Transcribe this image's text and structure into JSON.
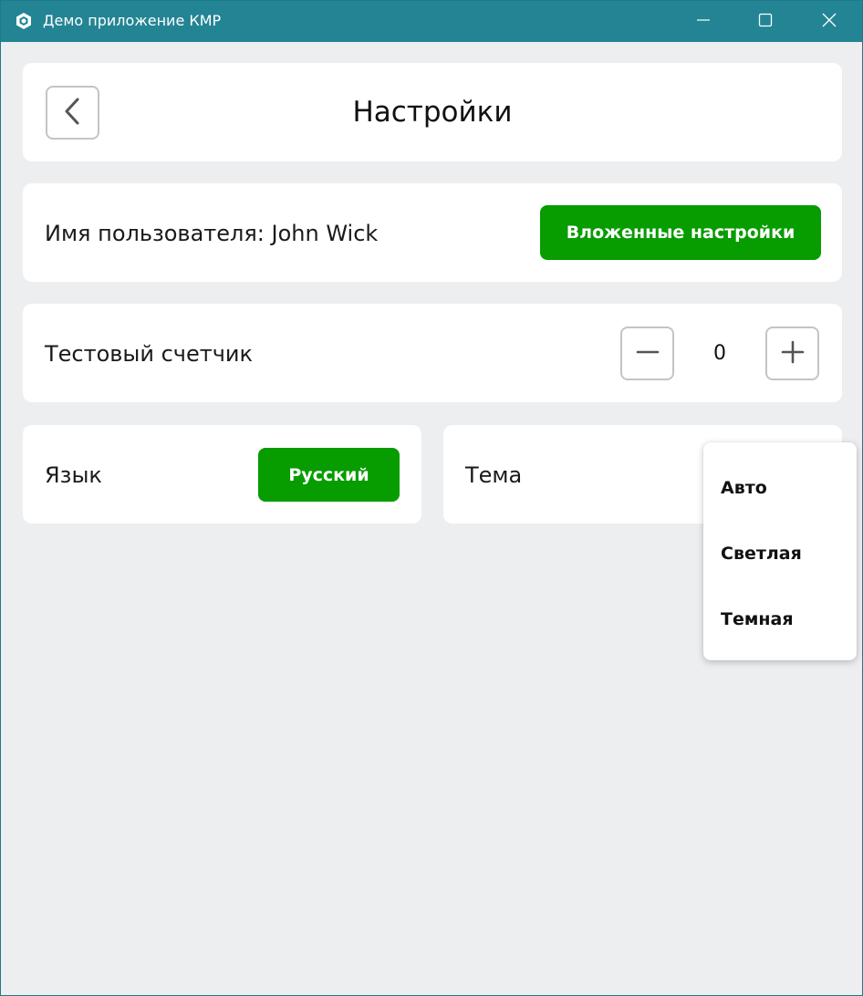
{
  "window": {
    "title": "Демо приложение КМР",
    "accent_color": "#238494",
    "icons": [
      "app-icon",
      "minimize-icon",
      "maximize-icon",
      "close-icon"
    ]
  },
  "header": {
    "title": "Настройки",
    "back_icon": "chevron-left-icon"
  },
  "user": {
    "label": "Имя пользователя: John Wick",
    "nested_button": "Вложенные настройки"
  },
  "counter": {
    "label": "Тестовый счетчик",
    "value": "0",
    "decrement_icon": "minus-icon",
    "increment_icon": "plus-icon"
  },
  "language": {
    "label": "Язык",
    "value": "Русский"
  },
  "theme": {
    "label": "Тема",
    "options": [
      "Авто",
      "Светлая",
      "Темная"
    ]
  },
  "colors": {
    "primary_green": "#079c00",
    "background": "#edeef0",
    "card": "#ffffff"
  }
}
